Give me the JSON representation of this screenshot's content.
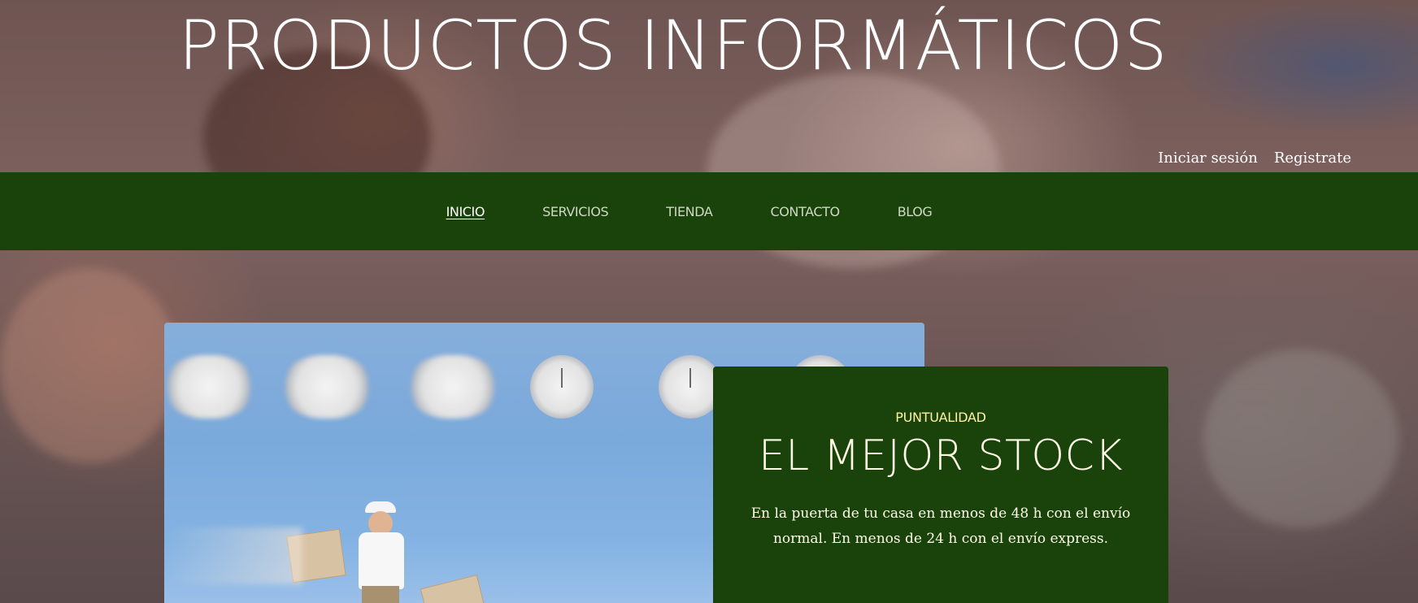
{
  "header": {
    "title": "PRODUCTOS INFORMÁTICOS"
  },
  "auth": {
    "login_label": "Iniciar sesión",
    "register_label": "Registrate"
  },
  "nav": {
    "items": [
      {
        "label": "INICIO",
        "active": true
      },
      {
        "label": "SERVICIOS",
        "active": false
      },
      {
        "label": "TIENDA",
        "active": false
      },
      {
        "label": "CONTACTO",
        "active": false
      },
      {
        "label": "BLOG",
        "active": false
      }
    ]
  },
  "promo": {
    "eyebrow": "PUNTUALIDAD",
    "title": "EL MEJOR STOCK",
    "text": "En la puerta de tu casa en menos de 48 h con el envío normal. En menos de 24 h con el envío express."
  },
  "colors": {
    "nav_background": "#1a420b",
    "card_background": "#1a420b",
    "eyebrow_color": "#fff3a0"
  }
}
